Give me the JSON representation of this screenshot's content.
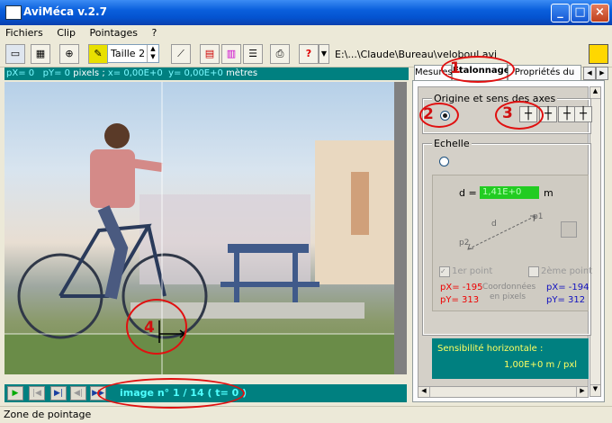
{
  "window": {
    "title": "AviMéca v.2.7"
  },
  "menu": [
    "Fichiers",
    "Clip",
    "Pointages",
    "?"
  ],
  "toolbar": {
    "taille_label": "Taille 2",
    "file_path": "E:\\...\\Claude\\Bureau\\veloboul.avi",
    "help_label": "?"
  },
  "coords": {
    "px": "pX= 0",
    "py": "pY= 0",
    "pixels_unit": "pixels",
    "x": "x=  0,00E+0",
    "y": "y=  0,00E+0",
    "metres_unit": "mètres"
  },
  "tabs": [
    "Mesures",
    "Etalonnage",
    "Propriétés du clip"
  ],
  "etalonnage": {
    "origin_group": "Origine et sens des axes",
    "scale_group": "Echelle",
    "d_label": "d =",
    "d_value": "1,41E+0",
    "d_unit": "m",
    "diagram_d": "d",
    "diagram_p1": "p1",
    "diagram_p2": "p2",
    "point1_label": "1er point",
    "point2_label": "2ème point",
    "p1_px": "pX= -195",
    "p1_py": "pY= 313",
    "coord_caption_1": "Coordonnées",
    "coord_caption_2": "en pixels",
    "p2_px": "pX= -194",
    "p2_py": "pY= 312",
    "sens_title": "Sensibilité horizontale :",
    "sens_value": "1,00E+0 m / pxl"
  },
  "playback": {
    "image_label": "image n° 1 / 14   ( t= 0 )"
  },
  "status": {
    "text": "Zone de pointage"
  },
  "annotations": [
    "1",
    "2",
    "3",
    "4"
  ],
  "colors": {
    "teal": "#008080",
    "annotation_red": "#e01010",
    "green_input": "#22cc22"
  }
}
